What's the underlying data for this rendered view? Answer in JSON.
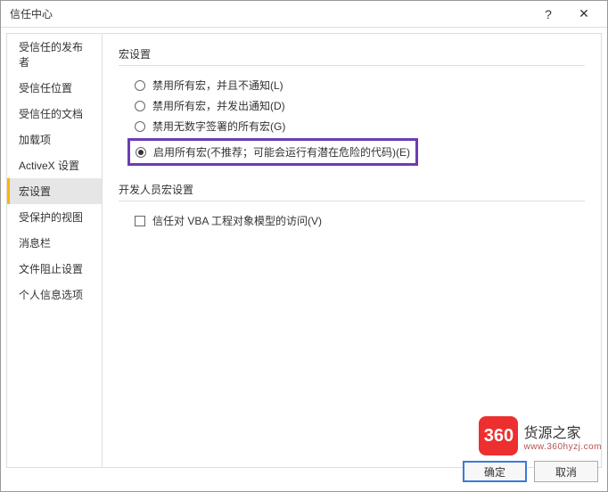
{
  "window": {
    "title": "信任中心",
    "help_glyph": "?",
    "close_glyph": "✕"
  },
  "sidebar": {
    "items": [
      {
        "label": "受信任的发布者"
      },
      {
        "label": "受信任位置"
      },
      {
        "label": "受信任的文档"
      },
      {
        "label": "加载项"
      },
      {
        "label": "ActiveX 设置"
      },
      {
        "label": "宏设置"
      },
      {
        "label": "受保护的视图"
      },
      {
        "label": "消息栏"
      },
      {
        "label": "文件阻止设置"
      },
      {
        "label": "个人信息选项"
      }
    ],
    "active_index": 5
  },
  "sections": {
    "macro": {
      "title": "宏设置",
      "options": [
        {
          "label": "禁用所有宏，并且不通知(L)",
          "checked": false
        },
        {
          "label": "禁用所有宏，并发出通知(D)",
          "checked": false
        },
        {
          "label": "禁用无数字签署的所有宏(G)",
          "checked": false
        },
        {
          "label": "启用所有宏(不推荐；可能会运行有潜在危险的代码)(E)",
          "checked": true,
          "highlighted": true
        }
      ]
    },
    "dev": {
      "title": "开发人员宏设置",
      "checkbox": {
        "label": "信任对 VBA 工程对象模型的访问(V)",
        "checked": false
      }
    }
  },
  "footer": {
    "ok": "确定",
    "cancel": "取消"
  },
  "watermark": {
    "badge": "360",
    "line1": "货源之家",
    "line2": "www.360hyzj.com"
  }
}
